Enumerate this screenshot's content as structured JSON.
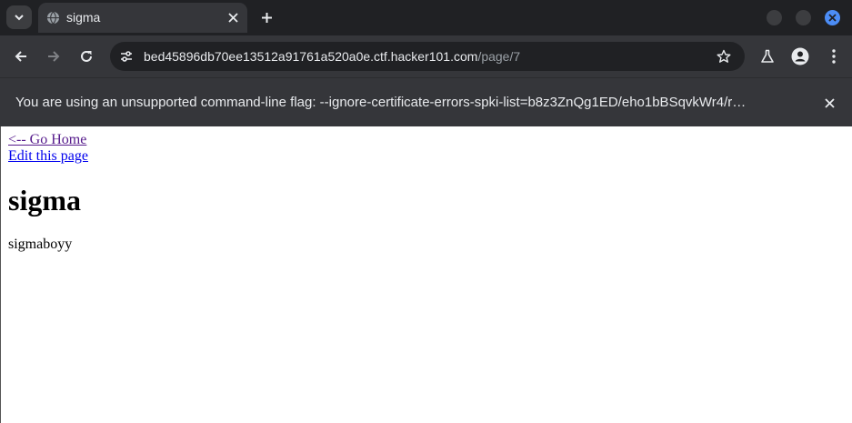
{
  "browser": {
    "tab_title": "sigma",
    "url_host": "bed45896db70ee13512a91761a520a0e.ctf.hacker101.com",
    "url_path": "/page/7",
    "infobar_message": "You are using an unsupported command-line flag: --ignore-certificate-errors-spki-list=b8z3ZnQg1ED/eho1bBSqvkWr4/r…",
    "icons": {
      "tab_search": "chevron-down-icon",
      "favicon": "globe-icon",
      "tab_close": "close-icon",
      "new_tab": "plus-icon",
      "back": "arrow-left-icon",
      "forward": "arrow-right-icon",
      "reload": "reload-icon",
      "site_info": "tune-icon",
      "bookmark": "star-icon",
      "labs": "flask-icon",
      "profile": "account-icon",
      "menu": "kebab-menu-icon"
    },
    "colors": {
      "frame": "#202124",
      "toolbar": "#35363a",
      "close_window": "#4c8df6"
    }
  },
  "page": {
    "home_link": "<-- Go Home",
    "edit_link": "Edit this page",
    "heading": "sigma",
    "body_text": "sigmaboyy",
    "colors": {
      "visited_link": "#551a8b",
      "link": "#0000ee"
    }
  }
}
